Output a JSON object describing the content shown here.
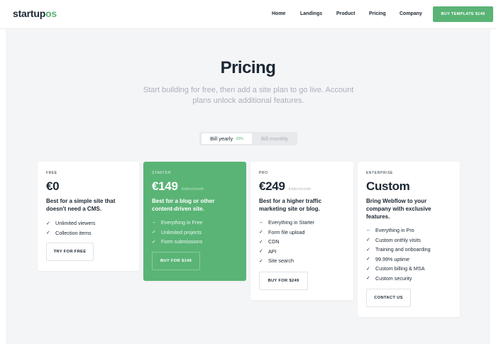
{
  "header": {
    "logo_main": "startup",
    "logo_accent": "os",
    "nav": [
      "Home",
      "Landings",
      "Product",
      "Pricing",
      "Company"
    ],
    "cta_label": "BUY TEMPLATE $149"
  },
  "pricing": {
    "title": "Pricing",
    "subtitle": "Start building for free, then add a site plan to go live. Account plans unlock additional features.",
    "billing": {
      "yearly_label": "Bill yearly",
      "yearly_badge": "-20%",
      "monthly_label": "Bill monthly",
      "selected": "yearly"
    }
  },
  "plans": [
    {
      "tier": "FREE",
      "price": "€0",
      "unit": "",
      "description": "Best for a simple site that doesn't need a CMS.",
      "features": [
        {
          "icon": "check-icon",
          "text": "Unlimited viewers"
        },
        {
          "icon": "check-icon",
          "text": "Collection items"
        }
      ],
      "button": "TRY FOR FREE"
    },
    {
      "tier": "STARTER",
      "price": "€149",
      "unit": "Editor/month",
      "description": "Best for a blog or other content-driven site.",
      "features": [
        {
          "icon": "arrow-left-icon",
          "text": "Everything in Free"
        },
        {
          "icon": "check-icon",
          "text": "Unlimited projects"
        },
        {
          "icon": "check-icon",
          "text": "Form submissions"
        }
      ],
      "button": "BUY FOR $149"
    },
    {
      "tier": "PRO",
      "price": "€249",
      "unit": "Editor/month",
      "description": "Best for a higher traffic marketing site or blog.",
      "features": [
        {
          "icon": "arrow-left-icon",
          "text": "Everything in Starter"
        },
        {
          "icon": "check-icon",
          "text": "Form file upload"
        },
        {
          "icon": "check-icon",
          "text": "CDN"
        },
        {
          "icon": "check-icon",
          "text": "API"
        },
        {
          "icon": "check-icon",
          "text": "Site search"
        }
      ],
      "button": "BUY FOR $249"
    },
    {
      "tier": "ENTERPRISE",
      "price": "Custom",
      "unit": "",
      "description": "Bring Webflow to your company with exclusive features.",
      "features": [
        {
          "icon": "arrow-left-icon",
          "text": "Everything in Pro"
        },
        {
          "icon": "check-icon",
          "text": "Custom onthly visits"
        },
        {
          "icon": "check-icon",
          "text": "Training and onboarding"
        },
        {
          "icon": "check-icon",
          "text": "99.99% uptime"
        },
        {
          "icon": "check-icon",
          "text": "Custom billing & MSA"
        },
        {
          "icon": "check-icon",
          "text": "Custom security"
        }
      ],
      "button": "CONTACT US"
    }
  ],
  "colors": {
    "accent": "#5ab476",
    "text": "#1b2733",
    "muted": "#a9b1b9",
    "section_bg": "#f4f5f7"
  }
}
